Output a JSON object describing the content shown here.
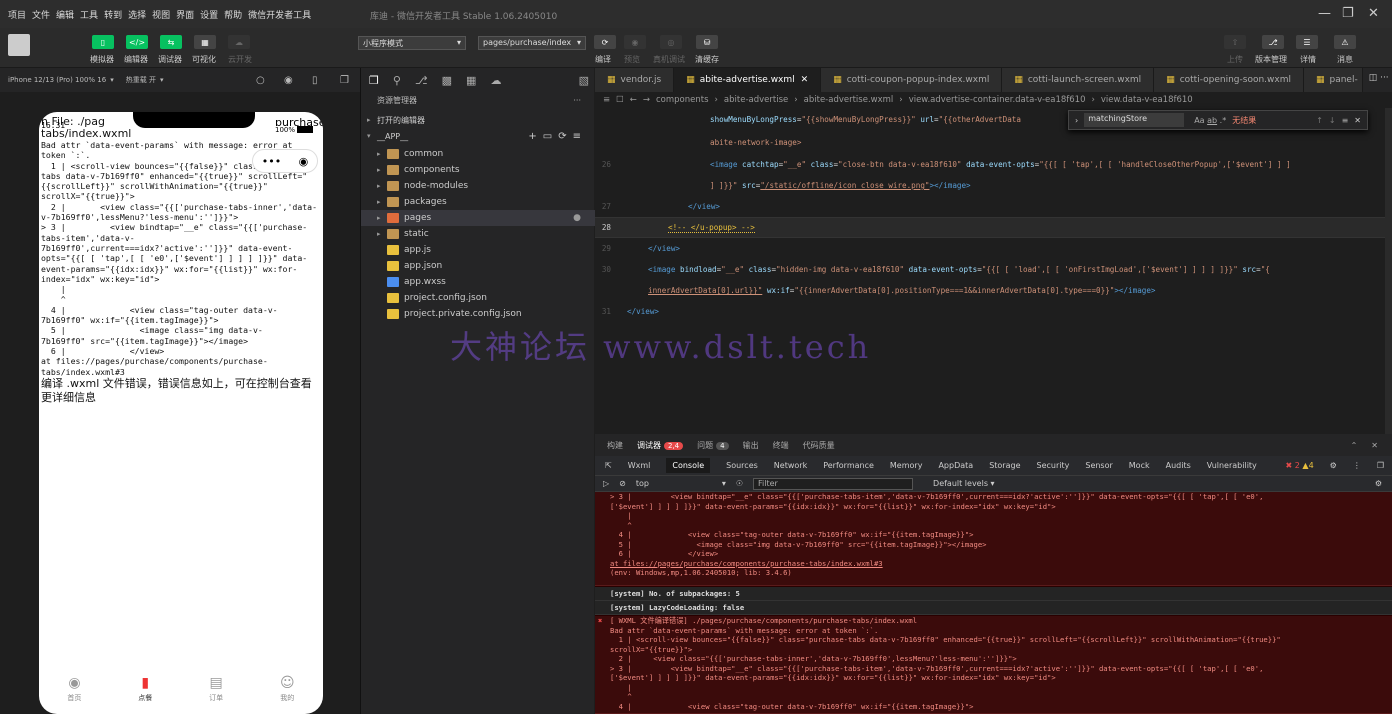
{
  "menubar": {
    "items": [
      "项目",
      "文件",
      "编辑",
      "工具",
      "转到",
      "选择",
      "视图",
      "界面",
      "设置",
      "帮助",
      "微信开发者工具"
    ],
    "title": "库迪 - 微信开发者工具 Stable 1.06.2405010"
  },
  "toolbar": {
    "buttons": [
      "模拟器",
      "编辑器",
      "调试器",
      "可视化",
      "云开发"
    ],
    "mode_select": "小程序模式",
    "page_select": "pages/purchase/index",
    "mid_labels": [
      "编译",
      "预览",
      "真机调试",
      "清缓存"
    ],
    "right_labels": [
      "上传",
      "版本管理",
      "详情",
      "消息"
    ]
  },
  "simulator": {
    "device": "iPhone 12/13 (Pro) 100% 16",
    "hot_reload": "热重载 开",
    "status_time": "16:31",
    "status_battery": "100%",
    "error_lines": [
      "n File: ./pag",
      "tabs/index.wxml",
      "Bad attr `data-event-params` with message: error at",
      "token `:`.",
      "  1 | <scroll-view bounces=\"{{false}}\" class=\"purchase-",
      "tabs data-v-7b169ff0\" enhanced=\"{{true}}\" scrollLeft=\"",
      "{{scrollLeft}}\" scrollWithAnimation=\"{{true}}\"",
      "scrollX=\"{{true}}\">",
      "  2 |       <view class=\"{{['purchase-tabs-inner','data-",
      "v-7b169ff0',lessMenu?'less-menu':'']}}\">",
      "> 3 |         <view bindtap=\"__e\" class=\"{{['purchase-",
      "tabs-item','data-v-",
      "7b169ff0',current===idx?'active':'']}}\" data-event-",
      "opts=\"{{[ [ 'tap',[ [ 'e0',['$event'] ] ] ] ]}}\" data-",
      "event-params=\"{{idx:idx}}\" wx:for=\"{{list}}\" wx:for-",
      "index=\"idx\" wx:key=\"id\">",
      "    |",
      "    ^",
      "  4 |             <view class=\"tag-outer data-v-",
      "7b169ff0\" wx:if=\"{{item.tagImage}}\">",
      "  5 |               <image class=\"img data-v-",
      "7b169ff0\" src=\"{{item.tagImage}}\"></image>",
      "  6 |             </view>",
      "at files://pages/purchase/components/purchase-",
      "tabs/index.wxml#3"
    ],
    "error_suffix": "purchase-",
    "compile_message": "编译 .wxml 文件错误，错误信息如上，可在控制台查看更详细信息",
    "tabs": [
      {
        "label": "首页",
        "icon": "home-icon"
      },
      {
        "label": "点餐",
        "icon": "cup-icon"
      },
      {
        "label": "订单",
        "icon": "order-icon"
      },
      {
        "label": "我的",
        "icon": "user-icon"
      }
    ]
  },
  "explorer": {
    "title": "资源管理器",
    "open_editors": "打开的编辑器",
    "project": "__APP__",
    "items": [
      {
        "name": "common",
        "type": "folder"
      },
      {
        "name": "components",
        "type": "folder"
      },
      {
        "name": "node-modules",
        "type": "folder"
      },
      {
        "name": "packages",
        "type": "folder"
      },
      {
        "name": "pages",
        "type": "folder-pages"
      },
      {
        "name": "static",
        "type": "folder"
      },
      {
        "name": "app.js",
        "type": "js"
      },
      {
        "name": "app.json",
        "type": "json"
      },
      {
        "name": "app.wxss",
        "type": "wxss"
      },
      {
        "name": "project.config.json",
        "type": "json"
      },
      {
        "name": "project.private.config.json",
        "type": "json"
      }
    ]
  },
  "editor": {
    "tabs": [
      "vendor.js",
      "abite-advertise.wxml",
      "cotti-coupon-popup-index.wxml",
      "cotti-launch-screen.wxml",
      "cotti-opening-soon.wxml",
      "panel-"
    ],
    "breadcrumbs": [
      "components",
      "abite-advertise",
      "abite-advertise.wxml",
      "view.advertise-container.data-v-ea18f610",
      "view.data-v-ea18f610"
    ],
    "find_query": "matchingStore",
    "find_result": "无结果",
    "line_numbers": [
      "26",
      "27",
      "28",
      "29",
      "30",
      "31"
    ],
    "watermark": "大神论坛  www.dslt.tech"
  },
  "devtools": {
    "top_tabs": [
      "构建",
      "调试器",
      "问题",
      "输出",
      "终端",
      "代码质量"
    ],
    "debugger_count": "2,4",
    "problems_count": "4",
    "console_tabs": [
      "Wxml",
      "Console",
      "Sources",
      "Network",
      "Performance",
      "Memory",
      "AppData",
      "Storage",
      "Security",
      "Sensor",
      "Mock",
      "Audits",
      "Vulnerability"
    ],
    "error_count": "2",
    "warn_count": "4",
    "context": "top",
    "filter_placeholder": "Filter",
    "levels": "Default levels",
    "block1": "> 3 |         <view bindtap=\"__e\" class=\"{{['purchase-tabs-item','data-v-7b169ff0',current===idx?'active':'']}}\" data-event-opts=\"{{[ [ 'tap',[ [ 'e0',\n['$event'] ] ] ] ]}}\" data-event-params=\"{{idx:idx}}\" wx:for=\"{{list}}\" wx:for-index=\"idx\" wx:key=\"id\">\n    |\n    ^\n  4 |             <view class=\"tag-outer data-v-7b169ff0\" wx:if=\"{{item.tagImage}}\">\n  5 |               <image class=\"img data-v-7b169ff0\" src=\"{{item.tagImage}}\"></image>\n  6 |             </view>",
    "block1_at": "at files://pages/purchase/components/purchase-tabs/index.wxml#3",
    "block1_env": "(env: Windows,mp,1.06.2405010; lib: 3.4.6)",
    "sys1": "[system] No. of subpackages: 5",
    "sys2": "[system] LazyCodeLoading: false",
    "block2": "[ WXML 文件编译错误] ./pages/purchase/components/purchase-tabs/index.wxml\nBad attr `data-event-params` with message: error at token `:`.\n  1 | <scroll-view bounces=\"{{false}}\" class=\"purchase-tabs data-v-7b169ff0\" enhanced=\"{{true}}\" scrollLeft=\"{{scrollLeft}}\" scrollWithAnimation=\"{{true}}\"\nscrollX=\"{{true}}\">\n  2 |     <view class=\"{{['purchase-tabs-inner','data-v-7b169ff0',lessMenu?'less-menu':'']}}\">\n> 3 |         <view bindtap=\"__e\" class=\"{{['purchase-tabs-item','data-v-7b169ff0',current===idx?'active':'']}}\" data-event-opts=\"{{[ [ 'tap',[ [ 'e0',\n['$event'] ] ] ] ]}}\" data-event-params=\"{{idx:idx}}\" wx:for=\"{{list}}\" wx:for-index=\"idx\" wx:key=\"id\">\n    |\n    ^\n  4 |             <view class=\"tag-outer data-v-7b169ff0\" wx:if=\"{{item.tagImage}}\">"
  },
  "colors": {
    "accent_green": "#07c160",
    "error_red": "#e64a4a",
    "console_bg": "#290000"
  }
}
